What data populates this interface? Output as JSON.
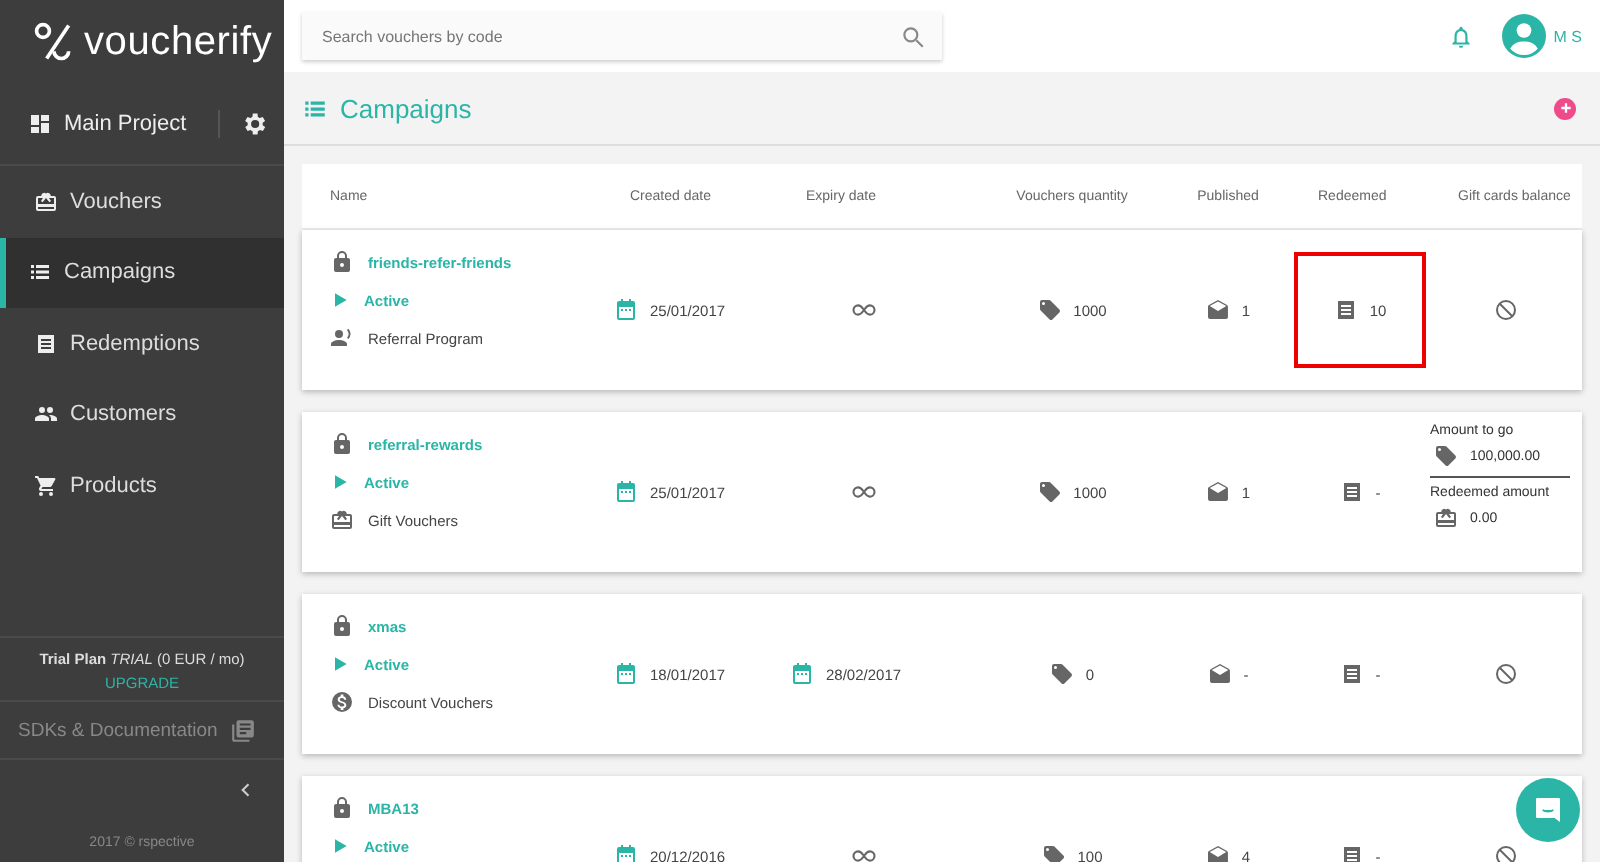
{
  "sidebar": {
    "logo": "voucherify",
    "project": "Main Project",
    "items": [
      {
        "label": "Vouchers",
        "kind": "gift",
        "selected": false
      },
      {
        "label": "Campaigns",
        "kind": "list",
        "selected": true
      },
      {
        "label": "Redemptions",
        "kind": "receipt",
        "selected": false
      },
      {
        "label": "Customers",
        "kind": "people",
        "selected": false
      },
      {
        "label": "Products",
        "kind": "cart",
        "selected": false
      }
    ],
    "plan": "**Trial Plan** *TRIAL* (0 EUR / mo)",
    "upgrade": "UPGRADE",
    "docs": "SDKs & Documentation",
    "copyright": "2017 © rspective"
  },
  "topbar": {
    "search_placeholder": "Search vouchers by code",
    "user_initials": "M S"
  },
  "page_title": "Campaigns",
  "table": {
    "columns": [
      "Name",
      "Created date",
      "Expiry date",
      "Vouchers quantity",
      "Published",
      "Redeemed",
      "Gift cards balance"
    ],
    "rows": [
      {
        "name": "friends-refer-friends",
        "status": "Active",
        "type": {
          "kind": "referral",
          "label": "Referral Program"
        },
        "created": "25/01/2017",
        "expiry": {
          "kind": "unlimited"
        },
        "quantity": "1000",
        "published": "1",
        "redeemed": "10",
        "redeemed_highlighted": true,
        "gift": {
          "kind": "none"
        }
      },
      {
        "name": "referral-rewards",
        "status": "Active",
        "type": {
          "kind": "gift",
          "label": "Gift Vouchers"
        },
        "created": "25/01/2017",
        "expiry": {
          "kind": "unlimited"
        },
        "quantity": "1000",
        "published": "1",
        "redeemed": "-",
        "redeemed_highlighted": false,
        "gift": {
          "kind": "balance",
          "to_go_label": "Amount to go",
          "to_go": "100,000.00",
          "redeemed_label": "Redeemed amount",
          "redeemed": "0.00"
        }
      },
      {
        "name": "xmas",
        "status": "Active",
        "type": {
          "kind": "discount",
          "label": "Discount Vouchers"
        },
        "created": "18/01/2017",
        "expiry": {
          "kind": "date",
          "text": "28/02/2017"
        },
        "quantity": "0",
        "published": "-",
        "redeemed": "-",
        "redeemed_highlighted": false,
        "gift": {
          "kind": "none"
        }
      },
      {
        "name": "MBA13",
        "status": "Active",
        "created": "20/12/2016",
        "expiry": {
          "kind": "unlimited"
        },
        "quantity": "100",
        "published": "4",
        "redeemed": "-",
        "redeemed_highlighted": false,
        "gift": {
          "kind": "none"
        }
      }
    ]
  }
}
